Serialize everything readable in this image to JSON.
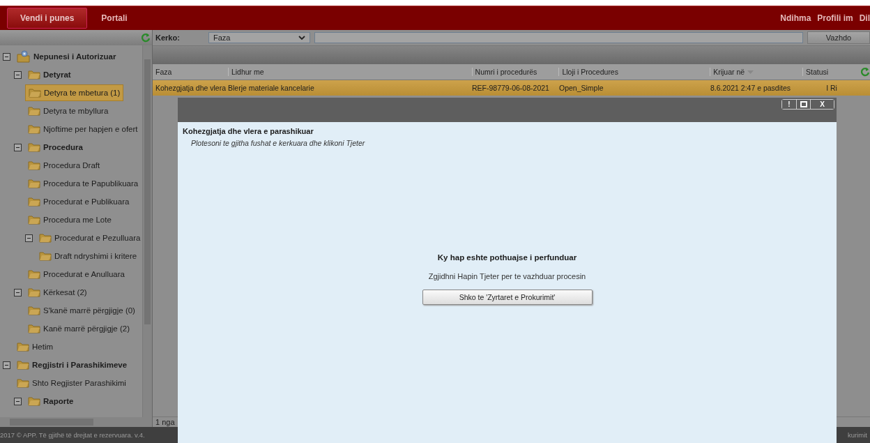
{
  "top_bar": {
    "tabs": [
      {
        "label": "Vendi i punes",
        "selected": true
      },
      {
        "label": "Portali",
        "selected": false
      }
    ],
    "links": [
      "Ndihma",
      "Profili im",
      "Dil"
    ]
  },
  "sidebar": {
    "tree": [
      {
        "label": "Nepunesi i Autorizuar",
        "kind": "root",
        "bold": true,
        "selected": false,
        "expanded": true,
        "children": [
          {
            "label": "Detyrat",
            "kind": "folder",
            "bold": true,
            "selected": false,
            "expanded": true,
            "children": [
              {
                "label": "Detyra te mbetura (1)",
                "kind": "folder",
                "bold": false,
                "selected": true
              },
              {
                "label": "Detyra te mbyllura",
                "kind": "folder",
                "bold": false,
                "selected": false
              },
              {
                "label": "Njoftime per hapjen e ofert",
                "kind": "folder",
                "bold": false,
                "selected": false
              }
            ]
          },
          {
            "label": "Procedura",
            "kind": "folder",
            "bold": true,
            "selected": false,
            "expanded": true,
            "children": [
              {
                "label": "Procedura Draft",
                "kind": "folder",
                "bold": false,
                "selected": false
              },
              {
                "label": "Procedura te Papublikuara",
                "kind": "folder",
                "bold": false,
                "selected": false
              },
              {
                "label": "Procedurat e Publikuara",
                "kind": "folder",
                "bold": false,
                "selected": false
              },
              {
                "label": "Procedura me Lote",
                "kind": "folder",
                "bold": false,
                "selected": false
              },
              {
                "label": "Procedurat e Pezulluara",
                "kind": "folder",
                "bold": false,
                "selected": false,
                "expanded": true,
                "children": [
                  {
                    "label": "Draft ndryshimi i kritere",
                    "kind": "folder",
                    "bold": false,
                    "selected": false
                  }
                ]
              },
              {
                "label": "Procedurat e Anulluara",
                "kind": "folder",
                "bold": false,
                "selected": false
              }
            ]
          },
          {
            "label": "Kërkesat (2)",
            "kind": "folder",
            "bold": false,
            "selected": false,
            "expanded": true,
            "children": [
              {
                "label": "S'kanë marrë përgjigje (0)",
                "kind": "folder",
                "bold": false,
                "selected": false
              },
              {
                "label": "Kanë marrë përgjigje (2)",
                "kind": "folder",
                "bold": false,
                "selected": false
              }
            ]
          },
          {
            "label": "Hetim",
            "kind": "folder",
            "bold": false,
            "selected": false
          }
        ]
      },
      {
        "label": "Regjistri i Parashikimeve",
        "kind": "folder",
        "bold": true,
        "selected": false,
        "expanded": true,
        "children": [
          {
            "label": "Shto Regjister Parashikimi",
            "kind": "folder",
            "bold": false,
            "selected": false
          },
          {
            "label": "Raporte",
            "kind": "folder",
            "bold": true,
            "selected": false,
            "expanded": true
          }
        ]
      }
    ]
  },
  "search": {
    "label": "Kerko:",
    "field": "Faza",
    "button": "Vazhdo"
  },
  "table": {
    "columns": [
      {
        "label": "Faza",
        "sorted": false
      },
      {
        "label": "Lidhur me",
        "sorted": false
      },
      {
        "label": "Numri i procedurës",
        "sorted": false
      },
      {
        "label": "Lloji i Procedures",
        "sorted": false
      },
      {
        "label": "Krijuar në",
        "sorted": true
      },
      {
        "label": "Statusi",
        "sorted": false
      }
    ],
    "rows": [
      {
        "selected": true,
        "cells": [
          "Kohezgjatja dhe vlera",
          "Blerje materiale kancelarie",
          "REF-98779-06-08-2021",
          "Open_Simple",
          "8.6.2021 2:47 e pasdites",
          "I Ri"
        ]
      }
    ]
  },
  "pager": "1 nga",
  "footer": {
    "copyright": "2017 © APP. Të gjithë të drejtat e rezervuara. v.4.",
    "right_text": "kurimit"
  },
  "dialog": {
    "controls": [
      "!",
      "X"
    ],
    "title": "Kohezgjatja dhe vlera e parashikuar",
    "instruction": "Plotesoni te gjitha fushat e kerkuara dhe klikoni Tjeter",
    "message_title": "Ky hap eshte pothuajse i perfunduar",
    "message": "Zgjidhni Hapin Tjeter per te vazhduar procesin",
    "button": "Shko te 'Zyrtaret e Prokurimit'"
  }
}
